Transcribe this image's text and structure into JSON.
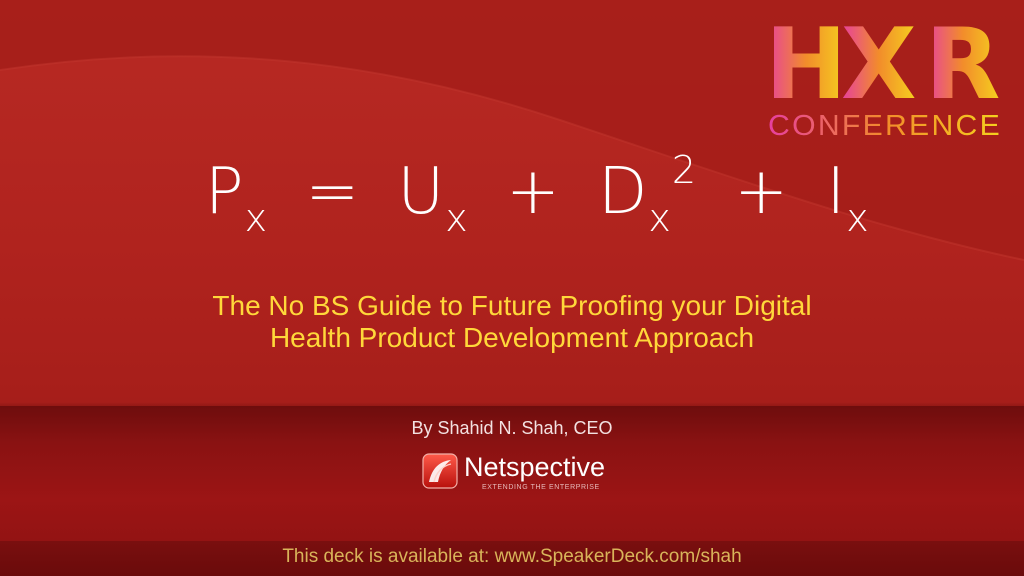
{
  "logo": {
    "hxr_letters": [
      "H",
      "X",
      "R"
    ],
    "conference": "CONFERENCE",
    "colors": {
      "magenta": "#e63fa0",
      "orange": "#f28c2b",
      "yellow": "#f5d21e"
    }
  },
  "formula": {
    "p": "P",
    "p_sub": "x",
    "eq": "=",
    "u": "U",
    "u_sub": "x",
    "plus1": "+",
    "d": "D",
    "d_sub": "x",
    "d_sup": "2",
    "plus2": "+",
    "i": "I",
    "i_sub": "x"
  },
  "subtitle": {
    "line1": "The No BS Guide to Future Proofing your Digital",
    "line2": "Health Product Development Approach"
  },
  "byline": "By Shahid N. Shah, CEO",
  "company": {
    "name": "Netspective",
    "tagline": "EXTENDING THE ENTERPRISE"
  },
  "footer": {
    "deck_text": "This deck is available at: www.SpeakerDeck.com/shah"
  },
  "colors": {
    "subtitle": "#ffd83a",
    "footer_text": "#d9b45a",
    "background": "#b0231e"
  }
}
